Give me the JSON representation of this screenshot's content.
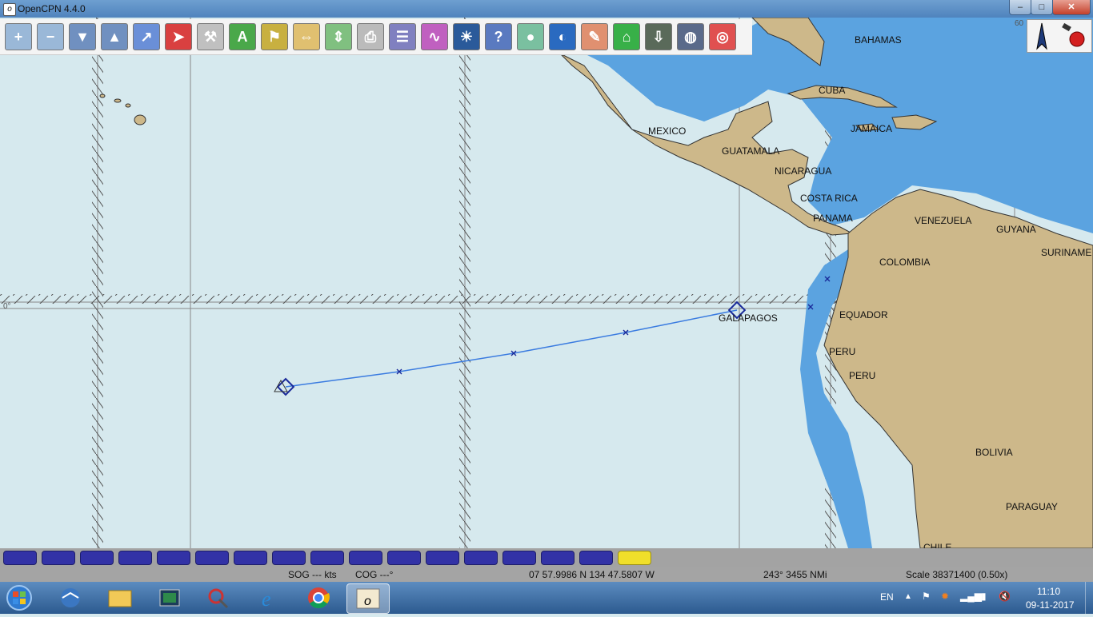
{
  "window": {
    "title": "OpenCPN 4.4.0",
    "minimize": "–",
    "maximize": "□",
    "close": "✕"
  },
  "toolbar": {
    "tools": [
      {
        "name": "zoom-in",
        "glyph": "+"
      },
      {
        "name": "zoom-out",
        "glyph": "−"
      },
      {
        "name": "scale-in",
        "glyph": "▼"
      },
      {
        "name": "scale-out",
        "glyph": "▲"
      },
      {
        "name": "route",
        "glyph": "↗"
      },
      {
        "name": "auto-follow",
        "glyph": "➤"
      },
      {
        "name": "options",
        "glyph": "⚒"
      },
      {
        "name": "text",
        "glyph": "A"
      },
      {
        "name": "current",
        "glyph": "⚑"
      },
      {
        "name": "tide",
        "glyph": "⇔"
      },
      {
        "name": "depth",
        "glyph": "⇕"
      },
      {
        "name": "print",
        "glyph": "⎙"
      },
      {
        "name": "route-manager",
        "glyph": "☰"
      },
      {
        "name": "track",
        "glyph": "∿"
      },
      {
        "name": "color-scheme",
        "glyph": "☀"
      },
      {
        "name": "help",
        "glyph": "?"
      },
      {
        "name": "ais",
        "glyph": "●"
      },
      {
        "name": "google-earth",
        "glyph": "◐"
      },
      {
        "name": "logbook",
        "glyph": "✎"
      },
      {
        "name": "lighthouse",
        "glyph": "⌂"
      },
      {
        "name": "download",
        "glyph": "⇩"
      },
      {
        "name": "globe",
        "glyph": "◍"
      },
      {
        "name": "mob",
        "glyph": "◎"
      }
    ]
  },
  "map": {
    "places": [
      {
        "label": "BAHAMAS"
      },
      {
        "label": "CUBA"
      },
      {
        "label": "MEXICO"
      },
      {
        "label": "JAMAICA"
      },
      {
        "label": "GUATAMALA"
      },
      {
        "label": "NICARAGUA"
      },
      {
        "label": "COSTA RICA"
      },
      {
        "label": "PANAMA"
      },
      {
        "label": "VENEZUELA"
      },
      {
        "label": "GUYANA"
      },
      {
        "label": "SURINAME"
      },
      {
        "label": "COLOMBIA"
      },
      {
        "label": "GALAPAGOS"
      },
      {
        "label": "EQUADOR"
      },
      {
        "label": "PERU"
      },
      {
        "label": "PERU"
      },
      {
        "label": "BOLIVIA"
      },
      {
        "label": "PARAGUAY"
      },
      {
        "label": "CHILE"
      }
    ],
    "equator_label": "0°",
    "grid_label": "60"
  },
  "piano": {
    "keys": 17,
    "active_index": 16
  },
  "status": {
    "sog": "SOG --- kts",
    "cog": "COG ---°",
    "position": "07 57.9986 N   134 47.5807 W",
    "bearing": "243°  3455 NMi",
    "scale": "Scale 38371400 (0.50x)"
  },
  "taskbar": {
    "language": "EN",
    "time": "11:10",
    "date": "09-11-2017"
  },
  "colors": {
    "sea": "#d6e9ee",
    "land": "#cdb88a",
    "shallow": "#5ba3e0",
    "route": "#3a7be0",
    "piano_key": "#3232a6",
    "piano_active": "#f0df2a"
  }
}
